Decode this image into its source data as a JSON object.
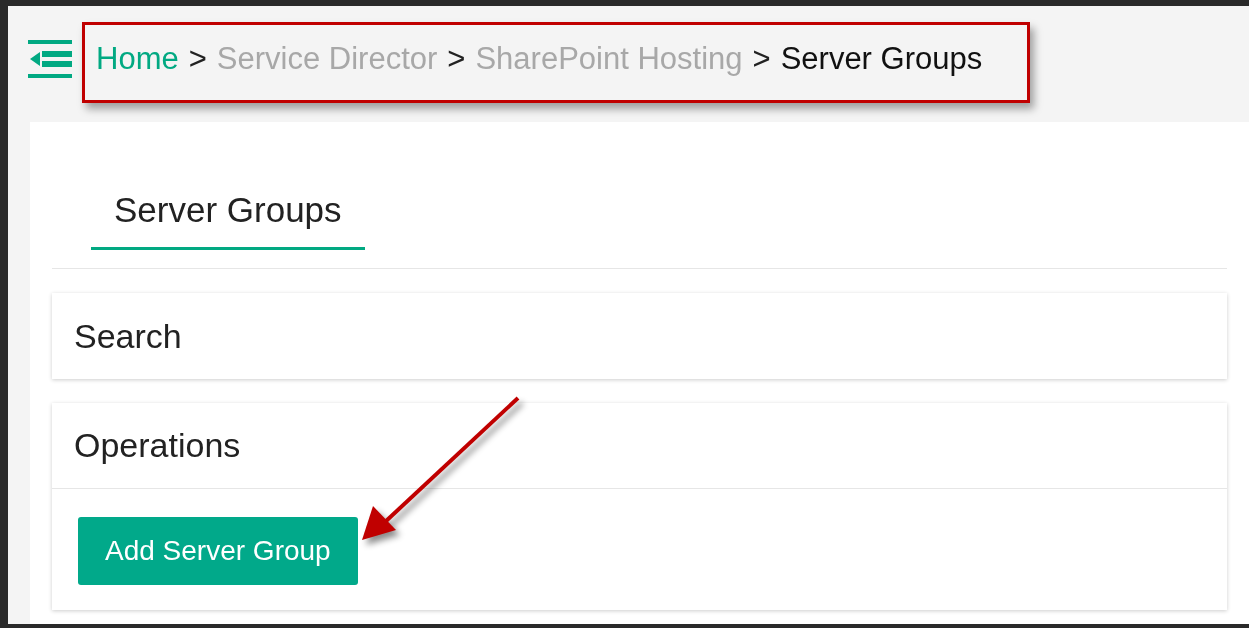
{
  "breadcrumb": [
    {
      "label": "Home",
      "kind": "link"
    },
    {
      "label": "Service Director",
      "kind": "inactive",
      "separator": ">"
    },
    {
      "label": "SharePoint Hosting",
      "kind": "inactive",
      "separator": ">"
    },
    {
      "label": "Server Groups",
      "kind": "current",
      "separator": ">"
    }
  ],
  "tabs": [
    {
      "label": "Server Groups",
      "selected": true
    }
  ],
  "panels": [
    {
      "title": "Search"
    },
    {
      "title": "Operations",
      "buttons": [
        "Add Server Group"
      ]
    }
  ],
  "annotations": {
    "highlight_box": true,
    "arrow": true
  }
}
